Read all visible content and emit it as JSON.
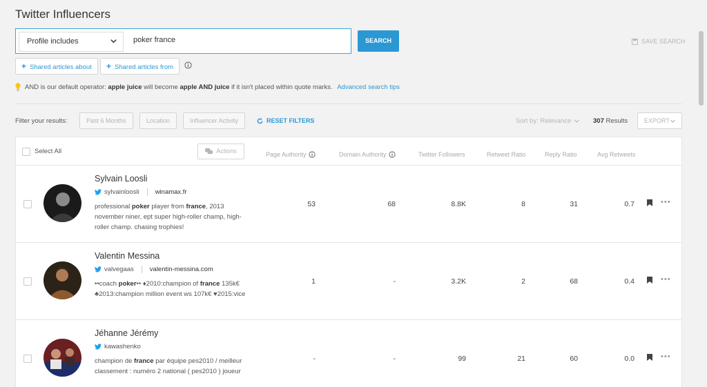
{
  "page_title": "Twitter Influencers",
  "search": {
    "filter_select": "Profile includes",
    "query": "poker france",
    "button": "SEARCH",
    "save_search": "SAVE SEARCH"
  },
  "shared_buttons": {
    "articles_about": "Shared articles about",
    "articles_from": "Shared articles from"
  },
  "tip": {
    "prefix": "AND is our default operator:",
    "term1": "apple juice",
    "middle": "will become",
    "term2": "apple AND juice",
    "suffix": "if it isn't placed within quote marks.",
    "link": "Advanced search tips"
  },
  "filters": {
    "label": "Filter your results:",
    "period": "Past 6 Months",
    "location": "Location",
    "activity": "Influencer Activity",
    "reset": "RESET FILTERS"
  },
  "sort": {
    "label": "Sort by: Relevance",
    "results_count": "307",
    "results_label": "Results",
    "export": "EXPORT"
  },
  "table": {
    "select_all": "Select All",
    "actions": "Actions",
    "columns": {
      "page_authority": "Page Authority",
      "domain_authority": "Domain Authority",
      "twitter_followers": "Twitter Followers",
      "retweet_ratio": "Retweet Ratio",
      "reply_ratio": "Reply Ratio",
      "avg_retweets": "Avg Retweets"
    },
    "rows": [
      {
        "name": "Sylvain Loosli",
        "handle": "sylvainloosli",
        "website": "winamax.fr",
        "bio": [
          {
            "t": "professional ",
            "b": false
          },
          {
            "t": "poker",
            "b": true
          },
          {
            "t": " player from ",
            "b": false
          },
          {
            "t": "france",
            "b": true
          },
          {
            "t": ", 2013 november niner, ept super high-roller champ, high-roller champ. chasing trophies!",
            "b": false
          }
        ],
        "page_authority": "53",
        "domain_authority": "68",
        "twitter_followers": "8.8K",
        "retweet_ratio": "8",
        "reply_ratio": "31",
        "avg_retweets": "0.7"
      },
      {
        "name": "Valentin Messina",
        "handle": "valvegaas",
        "website": "valentin-messina.com",
        "bio": [
          {
            "t": "••coach ",
            "b": false
          },
          {
            "t": "poker",
            "b": true
          },
          {
            "t": "•• ♦2010:champion of ",
            "b": false
          },
          {
            "t": "france",
            "b": true
          },
          {
            "t": " 135k€ ♣2013:champion million event ws 107k€ ♥2015:vice",
            "b": false
          }
        ],
        "page_authority": "1",
        "domain_authority": "-",
        "twitter_followers": "3.2K",
        "retweet_ratio": "2",
        "reply_ratio": "68",
        "avg_retweets": "0.4"
      },
      {
        "name": "Jéhanne Jérémy",
        "handle": "kawashenko",
        "website": "",
        "bio": [
          {
            "t": "champion de ",
            "b": false
          },
          {
            "t": "france",
            "b": true
          },
          {
            "t": " par équipe pes2010 / meilleur classement : numéro 2 national ( pes2010 ) joueur",
            "b": false
          }
        ],
        "page_authority": "-",
        "domain_authority": "-",
        "twitter_followers": "99",
        "retweet_ratio": "21",
        "reply_ratio": "60",
        "avg_retweets": "0.0"
      }
    ]
  },
  "colors": {
    "accent": "#2b98d3",
    "twitter": "#1da1f2",
    "tip_bulb": "#f5c518"
  }
}
